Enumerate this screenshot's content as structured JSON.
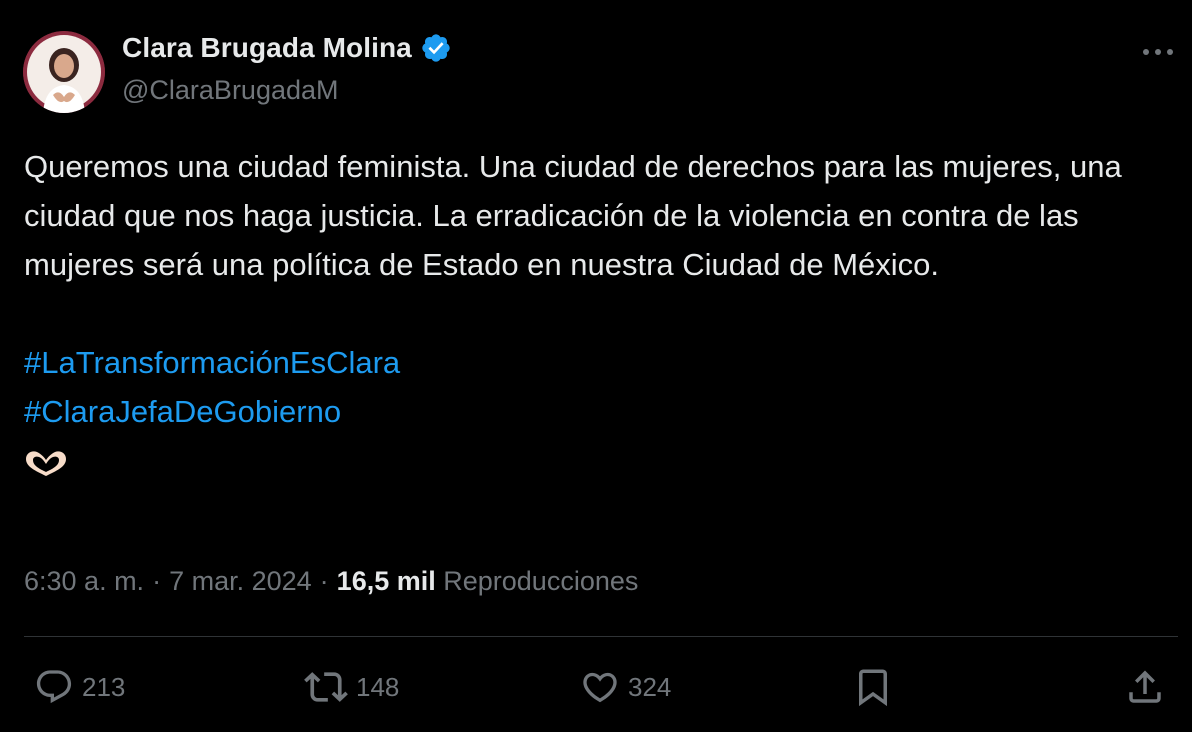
{
  "author": {
    "display_name": "Clara Brugada Molina",
    "handle": "@ClaraBrugadaM",
    "verified": true,
    "avatar_icon": "profile-photo"
  },
  "tweet": {
    "text": "Queremos una ciudad feminista. Una ciudad de derechos para las mujeres, una ciudad que nos haga justicia. La erradicación de la violencia en contra de las mujeres será una política de Estado en nuestra Ciudad de México.",
    "hashtags": [
      "#LaTransformaciónEsClara",
      "#ClaraJefaDeGobierno"
    ],
    "emoji": "🫶🏻"
  },
  "meta": {
    "time": "6:30 a. m.",
    "separator": "·",
    "date": "7 mar. 2024",
    "views_count": "16,5 mil",
    "views_label": "Reproducciones"
  },
  "actions": {
    "replies": "213",
    "retweets": "148",
    "likes": "324"
  },
  "colors": {
    "background": "#000000",
    "text": "#e7e9ea",
    "secondary": "#71767b",
    "link": "#1d9bf0",
    "verified_badge": "#1d9bf0"
  }
}
